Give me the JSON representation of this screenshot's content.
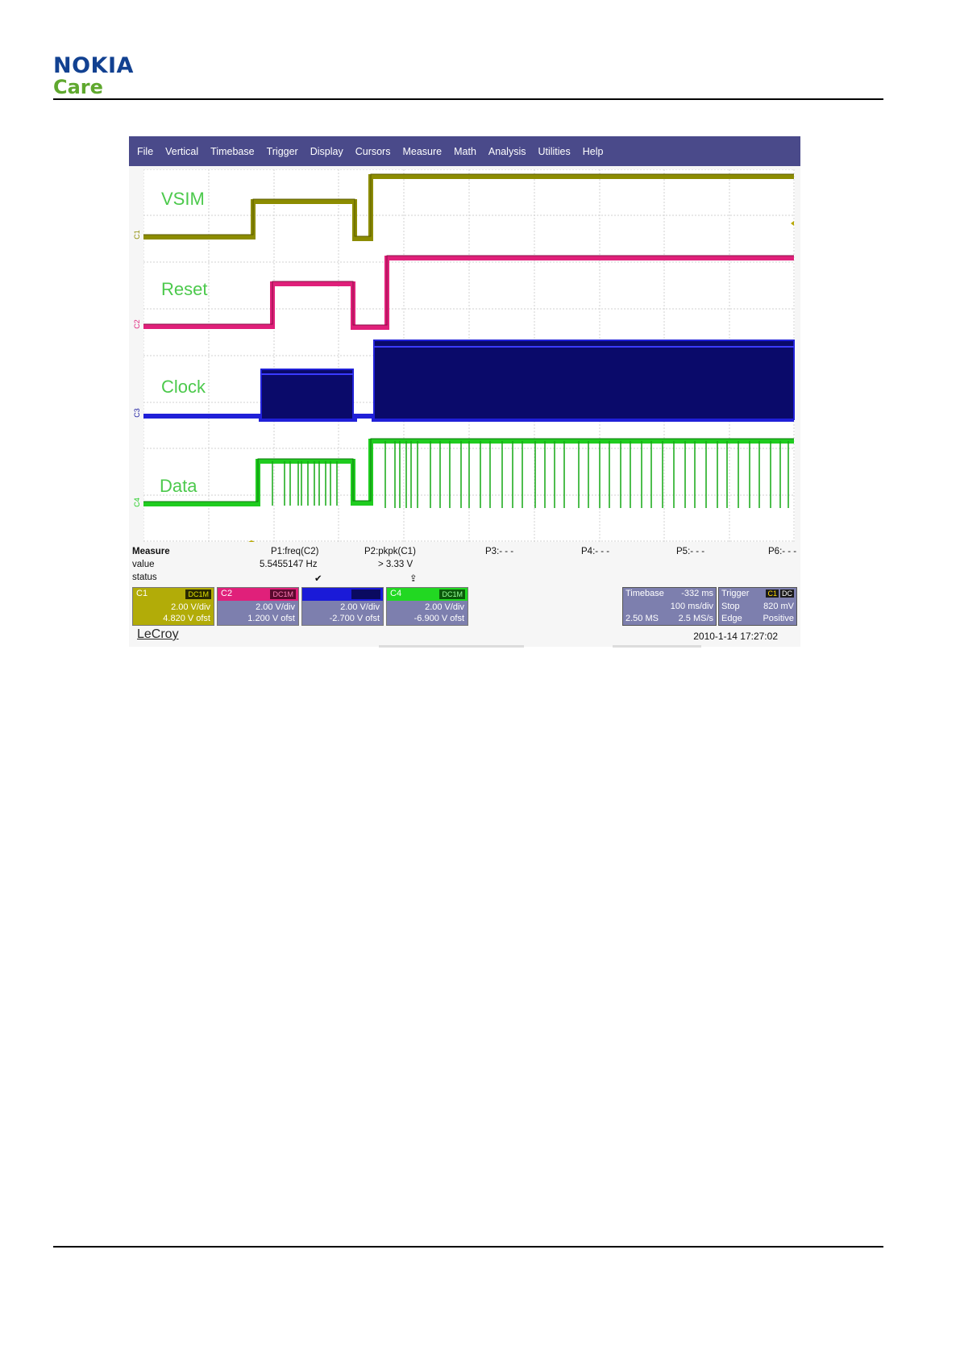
{
  "header": {
    "brand_main": "NOKIA",
    "brand_sub": "Care"
  },
  "menu": [
    "File",
    "Vertical",
    "Timebase",
    "Trigger",
    "Display",
    "Cursors",
    "Measure",
    "Math",
    "Analysis",
    "Utilities",
    "Help"
  ],
  "channels_labels": {
    "vsim": "VSIM",
    "reset": "Reset",
    "clock": "Clock",
    "data": "Data"
  },
  "colors": {
    "vsim": "#8c8c00",
    "reset": "#e0207a",
    "clock": "#1a1aa0",
    "data": "#1fcc1f",
    "menubar": "#4a4a8a",
    "panel": "#7d7fae"
  },
  "measure": {
    "row_labels": [
      "Measure",
      "value",
      "status"
    ],
    "params": [
      {
        "name": "P1:freq(C2)",
        "value": "5.5455147 Hz",
        "status": "✔"
      },
      {
        "name": "P2:pkpk(C1)",
        "value": "> 3.33 V",
        "status": "⇪"
      },
      {
        "name": "P3:- - -",
        "value": "",
        "status": ""
      },
      {
        "name": "P4:- - -",
        "value": "",
        "status": ""
      },
      {
        "name": "P5:- - -",
        "value": "",
        "status": ""
      },
      {
        "name": "P6:- - -",
        "value": "",
        "status": ""
      }
    ]
  },
  "channel_boxes": [
    {
      "tag": "C1",
      "coupling": "DC1M",
      "vdiv": "2.00 V/div",
      "offset": "4.820 V ofst"
    },
    {
      "tag": "C2",
      "coupling": "DC1M",
      "vdiv": "2.00 V/div",
      "offset": "1.200 V ofst"
    },
    {
      "tag": "",
      "coupling": "",
      "vdiv": "2.00 V/div",
      "offset": "-2.700 V ofst"
    },
    {
      "tag": "C4",
      "coupling": "DC1M",
      "vdiv": "2.00 V/div",
      "offset": "-6.900 V ofst"
    }
  ],
  "timebase": {
    "label": "Timebase",
    "delay": "-332 ms",
    "tdiv": "100 ms/div",
    "samples": "2.50 MS",
    "rate": "2.5 MS/s"
  },
  "trigger": {
    "label": "Trigger",
    "source": "C1",
    "coupling": "DC",
    "mode": "Stop",
    "level": "820 mV",
    "type": "Edge",
    "slope": "Positive"
  },
  "brand_footer": "LeCroy",
  "timestamp": "2010-1-14 17:27:02",
  "trace_markers": [
    "C1",
    "C2",
    "C3",
    "C4"
  ]
}
